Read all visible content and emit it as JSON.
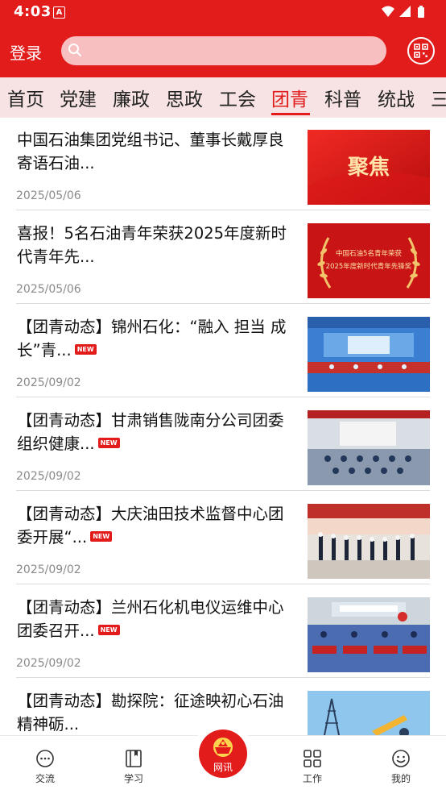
{
  "status_bar": {
    "time": "4:03",
    "notification_letter": "A"
  },
  "header": {
    "login_label": "登录",
    "search_placeholder": "",
    "qr_icon": "qr-code-icon"
  },
  "tabs": [
    {
      "label": "首页",
      "active": false
    },
    {
      "label": "党建",
      "active": false
    },
    {
      "label": "廉政",
      "active": false
    },
    {
      "label": "思政",
      "active": false
    },
    {
      "label": "工会",
      "active": false
    },
    {
      "label": "团青",
      "active": true
    },
    {
      "label": "科普",
      "active": false
    },
    {
      "label": "统战",
      "active": false
    },
    {
      "label": "三",
      "active": false
    }
  ],
  "news": [
    {
      "title": "中国石油集团党组书记、董事长戴厚良寄语石油...",
      "date": "2025/05/06",
      "new": false,
      "thumb_text": "聚焦"
    },
    {
      "title": "喜报！5名石油青年荣获2025年度新时代青年先...",
      "date": "2025/05/06",
      "new": false,
      "thumb_text": "中国石油5名青年荣获 2025年度新时代青年先锋奖"
    },
    {
      "title": "【团青动态】锦州石化：“融入 担当 成长”青...",
      "date": "2025/09/02",
      "new": true,
      "badge": "NEW"
    },
    {
      "title": "【团青动态】甘肃销售陇南分公司团委组织健康...",
      "date": "2025/09/02",
      "new": true,
      "badge": "NEW"
    },
    {
      "title": "【团青动态】大庆油田技术监督中心团委开展“...",
      "date": "2025/09/02",
      "new": true,
      "badge": "NEW"
    },
    {
      "title": "【团青动态】兰州石化机电仪运维中心团委召开...",
      "date": "2025/09/02",
      "new": true,
      "badge": "NEW"
    },
    {
      "title": "【团青动态】勘探院：征途映初心石油精神砺...",
      "date": "",
      "new": false
    }
  ],
  "bottom_nav": [
    {
      "label": "交流",
      "icon": "chat-icon"
    },
    {
      "label": "学习",
      "icon": "book-icon"
    },
    {
      "label": "网讯",
      "icon": "youth-league-emblem-icon"
    },
    {
      "label": "工作",
      "icon": "grid-icon"
    },
    {
      "label": "我的",
      "icon": "smile-icon"
    }
  ],
  "colors": {
    "brand_red": "#e21b1b",
    "tab_bg": "#f7e3e3"
  }
}
